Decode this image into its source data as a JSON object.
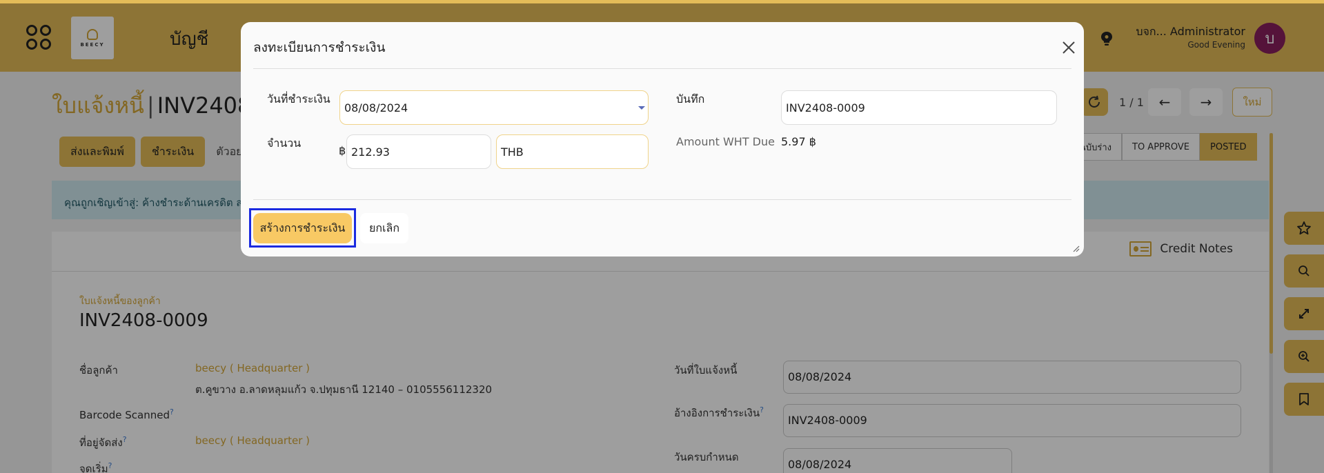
{
  "topbar": {
    "app_title": "บัญชี",
    "logo_text": "BEECY",
    "user_name": "บจก... Administrator",
    "greeting": "Good Evening",
    "avatar_initial": "บ"
  },
  "breadcrumb": {
    "parent": "ใบแจ้งหนี้",
    "separator": "|",
    "current": "INV2408-"
  },
  "pager": {
    "counter": "1 / 1",
    "prev": "←",
    "next": "→",
    "new_label": "ใหม่"
  },
  "actions": {
    "send_print": "ส่งและพิมพ์",
    "register_payment": "ชำระเงิน",
    "preview": "ตัวอย่"
  },
  "status_bar": {
    "draft": "ฉบับร่าง",
    "to_approve": "TO APPROVE",
    "posted": "POSTED"
  },
  "alert": {
    "text": "คุณถูกเชิญเข้าสู่: ค้างชำระด้านเครดิต ส"
  },
  "sheet_tabs": {
    "credit_notes": "Credit Notes"
  },
  "sheet": {
    "subtitle": "ใบแจ้งหนี้ของลูกค้า",
    "title": "INV2408-0009",
    "customer_label": "ชื่อลูกค้า",
    "customer_name": "beecy ( Headquarter )",
    "customer_address": "ต.คูขวาง อ.ลาดหลุมแก้ว จ.ปทุมธานี 12140 – 0105556112320",
    "barcode_label": "Barcode Scanned",
    "delivery_label": "ที่อยู่จัดส่ง",
    "delivery_value": "beecy ( Headquarter )",
    "start_label": "จุดเริ่ม",
    "invoice_date_label": "วันที่ใบแจ้งหนี้",
    "invoice_date": "08/08/2024",
    "payment_ref_label": "อ้างอิงการชำระเงิน",
    "payment_ref": "INV2408-0009",
    "due_date_label": "วันครบกำหนด",
    "due_date": "08/08/2024",
    "help_mark": "?"
  },
  "modal": {
    "title": "ลงทะเบียนการชำระเงิน",
    "payment_date_label": "วันที่ชำระเงิน",
    "payment_date": "08/08/2024",
    "memo_label": "บันทึก",
    "memo": "INV2408-0009",
    "amount_label": "จำนวน",
    "currency_symbol": "฿",
    "amount": "212.93",
    "currency": "THB",
    "wht_label": "Amount WHT Due",
    "wht_value": "5.97 ฿",
    "create_button": "สร้างการชำระเงิน",
    "cancel_button": "ยกเลิก"
  },
  "colors": {
    "brand": "#e4bc58",
    "brand_text": "#d4a637",
    "focus_ring": "#1a2ae0",
    "avatar": "#8a1f5e"
  },
  "icons": [
    "apps-icon",
    "bulb-icon",
    "refresh-icon",
    "star-icon",
    "search-icon",
    "expand-icon",
    "zoom-icon",
    "bookmark-icon",
    "close-icon",
    "caret-down-icon",
    "credit-notes-icon",
    "resize-icon"
  ]
}
